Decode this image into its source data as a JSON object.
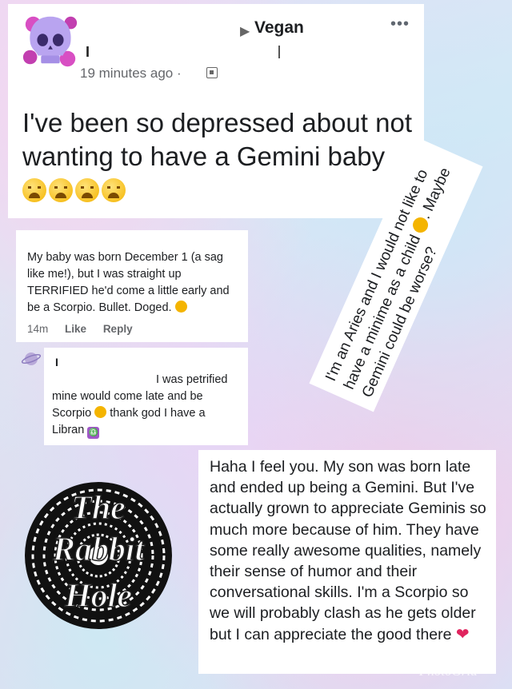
{
  "post": {
    "author": "I",
    "group": "Vegan",
    "more": "•••",
    "timestamp": "19 minutes ago ·",
    "text": "I've been so depressed about not wanting to have a Gemini baby"
  },
  "comment1": {
    "text": "My baby was born December 1 (a sag like me!), but I was straight up TERRIFIED he'd come a little early and be a Scorpio. Bullet. Doged.",
    "time": "14m",
    "like": "Like",
    "reply": "Reply"
  },
  "comment2": {
    "name": "I",
    "line1": "I was petrified",
    "line2": "mine would come late and be",
    "line3a": "Scorpio",
    "line3b": "thank god I have a",
    "line4": "Libran"
  },
  "rotated_reply": {
    "text_a": "I'm an Aries and I would not like to have a minime as a child",
    "text_b": ". Maybe Gemini could be worse?"
  },
  "reply": {
    "text": "Haha I feel you. My son was born late and ended up being a Gemini. But I've actually grown to appreciate Geminis so much more because of him. They have some really awesome qualities, namely their sense of humor and their conversational skills. I'm a Scorpio so we will probably clash as he gets older but I can appreciate the good there"
  },
  "logo": {
    "line1": "The",
    "line2": "Rabbit",
    "line3": "Hole"
  },
  "watermark": "PhotoGrid",
  "icons": {
    "avatar": "skull-icon",
    "arrow": "triangle-right-icon",
    "audience": "audience-icon",
    "weary": "weary-face-emoji",
    "planet": "planet-icon",
    "heart": "two-hearts-emoji"
  }
}
